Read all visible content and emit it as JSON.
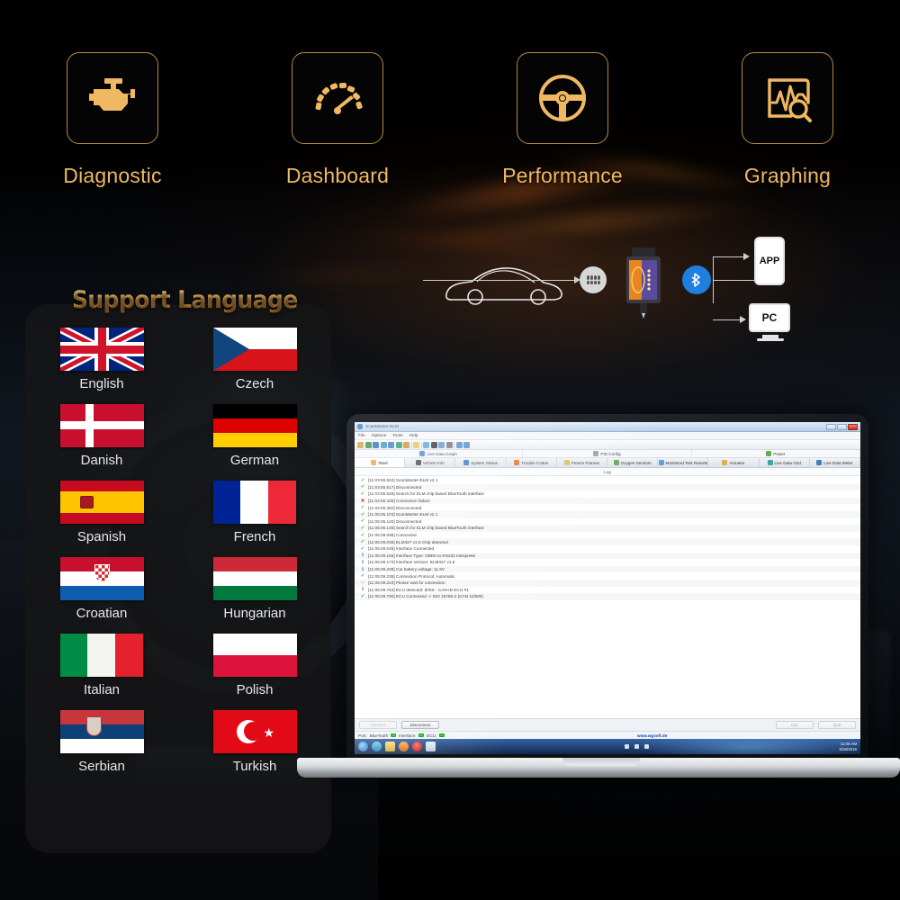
{
  "features": [
    {
      "label": "Diagnostic",
      "icon": "engine-check-icon"
    },
    {
      "label": "Dashboard",
      "icon": "gauge-icon"
    },
    {
      "label": "Performance",
      "icon": "steering-wheel-icon"
    },
    {
      "label": "Graphing",
      "icon": "graph-search-icon"
    }
  ],
  "diagram": {
    "obd_port": "obd-port-icon",
    "car": "car-silhouette-icon",
    "adapter": "elm327-adapter",
    "bluetooth": "bluetooth-icon",
    "phone_label": "APP",
    "pc_label": "PC"
  },
  "language_panel": {
    "title": "Support Language",
    "items": [
      {
        "name": "English",
        "flag": "flag-uk"
      },
      {
        "name": "Czech",
        "flag": "flag-cz"
      },
      {
        "name": "Danish",
        "flag": "flag-dk"
      },
      {
        "name": "German",
        "flag": "flag-de"
      },
      {
        "name": "Spanish",
        "flag": "flag-es"
      },
      {
        "name": "French",
        "flag": "flag-fr"
      },
      {
        "name": "Croatian",
        "flag": "flag-hr"
      },
      {
        "name": "Hungarian",
        "flag": "flag-hu"
      },
      {
        "name": "Italian",
        "flag": "flag-it"
      },
      {
        "name": "Polish",
        "flag": "flag-pl"
      },
      {
        "name": "Serbian",
        "flag": "flag-rs"
      },
      {
        "name": "Turkish",
        "flag": "flag-tr"
      }
    ]
  },
  "app": {
    "title": "ScanMaster-ELM",
    "menus": [
      "File",
      "Options",
      "Tools",
      "Help"
    ],
    "tabs_top": [
      "Live Data Graph",
      "PID Config",
      "Power"
    ],
    "tabs_main": [
      "Start",
      "Vehicle Info",
      "System Status",
      "Trouble Codes",
      "Freeze Frames",
      "Oxygen Sensors",
      "Monitored Test Results",
      "Actuator",
      "Live Data Grid",
      "Live Data Meter"
    ],
    "active_tab": "Start",
    "log_column": "Log",
    "log": [
      {
        "status": "ok",
        "text": "[11:03:55.504] ScanMaster-ELM v2.1"
      },
      {
        "status": "ok",
        "text": "[11:03:55.517] Disconnected"
      },
      {
        "status": "ok",
        "text": "[11:03:55.528] Search for ELM chip based BlueTooth interface"
      },
      {
        "status": "err",
        "text": "[11:04:00.345] Connection failure"
      },
      {
        "status": "ok",
        "text": "[11:04:00.350] Disconnected"
      },
      {
        "status": "ok",
        "text": "[11:05:05.103] ScanMaster-ELM v2.1"
      },
      {
        "status": "ok",
        "text": "[11:05:05.120] Disconnected"
      },
      {
        "status": "ok",
        "text": "[11:05:05.146] Search for ELM chip based BlueTooth interface"
      },
      {
        "status": "ok",
        "text": "[11:05:08.095] Connected"
      },
      {
        "status": "ok",
        "text": "[11:05:09.036] ELM327 v1.5 Chip detected"
      },
      {
        "status": "ok",
        "text": "[11:05:09.045] Interface Connected"
      },
      {
        "status": "info",
        "text": "[11:05:09.165] Interface Type: OBDII to RS232 Interpreter"
      },
      {
        "status": "info",
        "text": "[11:05:09.173] Interface Version: ELM327 v1.5"
      },
      {
        "status": "info",
        "text": "[11:05:09.208] Car battery voltage: 11.9V"
      },
      {
        "status": "ok",
        "text": "[11:05:09.238] Connection Protocol: Automatic"
      },
      {
        "status": "wait",
        "text": "[11:05:09.243] Please wait for connection"
      },
      {
        "status": "info",
        "text": "[11:05:09.753] ECU detected: $7E8 - CAN-ID ECU #1"
      },
      {
        "status": "ok",
        "text": "[11:05:09.790] ECU Connected -> ISO 15765-4 (CAN 11/500)"
      }
    ],
    "buttons": {
      "connect": "Connect",
      "disconnect": "Disconnect",
      "info": "Info",
      "quit": "Quit"
    },
    "status_bar": {
      "port_label": "Port:",
      "port_value": "BlueTooth",
      "interface_label": "Interface:",
      "ecu_label": "ECU:",
      "website": "www.wgsoft.de"
    },
    "taskbar": {
      "time": "11:06 AM",
      "date": "6/28/2016"
    }
  }
}
